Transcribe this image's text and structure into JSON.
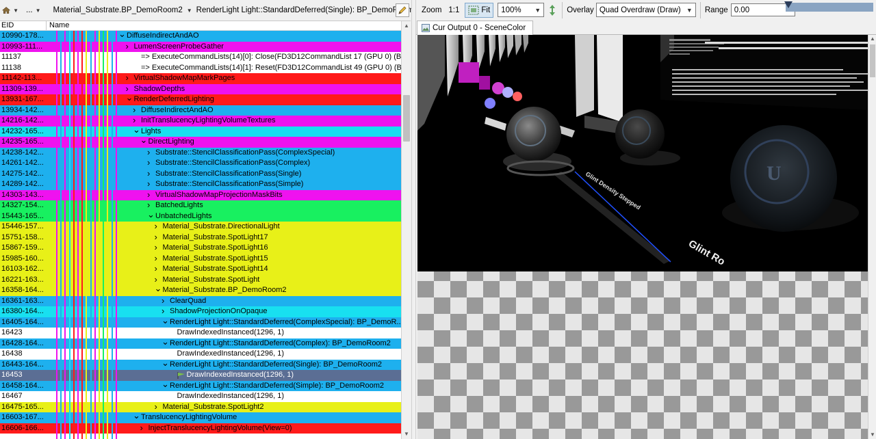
{
  "breadcrumb": {
    "home_icon": "home-icon",
    "item1": "Material_Substrate.BP_DemoRoom2",
    "item2": "RenderLight Light::StandardDeferred(Single): BP_DemoRoom2",
    "edit_icon": "pencil-icon"
  },
  "tree": {
    "columns": {
      "eid": "EID",
      "name": "Name"
    },
    "rows": [
      {
        "eid": "10990-178...",
        "name": "DiffuseIndirectAndAO",
        "color": "#1eb0ee",
        "depth": 0,
        "exp": "down"
      },
      {
        "eid": "10993-111...",
        "name": "LumenScreenProbeGather",
        "color": "#ef12ef",
        "depth": 1,
        "exp": "right"
      },
      {
        "eid": "11137",
        "name": "=> ExecuteCommandLists(14)[0]: Close(FD3D12CommandList 17 (GPU 0) (Bak",
        "color": "#ffffff",
        "depth": 2,
        "exp": ""
      },
      {
        "eid": "11138",
        "name": "=> ExecuteCommandLists(14)[1]: Reset(FD3D12CommandList 49 (GPU 0) (Bak",
        "color": "#ffffff",
        "depth": 2,
        "exp": ""
      },
      {
        "eid": "11142-113...",
        "name": "VirtualShadowMapMarkPages",
        "color": "#ff1a1a",
        "depth": 1,
        "exp": "right"
      },
      {
        "eid": "11309-139...",
        "name": "ShadowDepths",
        "color": "#ef12ef",
        "depth": 1,
        "exp": "right"
      },
      {
        "eid": "13931-167...",
        "name": "RenderDeferredLighting",
        "color": "#ff1a1a",
        "depth": 1,
        "exp": "down"
      },
      {
        "eid": "13934-142...",
        "name": "DiffuseIndirectAndAO",
        "color": "#1eb0ee",
        "depth": 2,
        "exp": "right"
      },
      {
        "eid": "14216-142...",
        "name": "InitTranslucencyLightingVolumeTextures",
        "color": "#ef12ef",
        "depth": 2,
        "exp": "right"
      },
      {
        "eid": "14232-165...",
        "name": "Lights",
        "color": "#18e0f0",
        "depth": 2,
        "exp": "down"
      },
      {
        "eid": "14235-165...",
        "name": "DirectLighting",
        "color": "#ef12ef",
        "depth": 3,
        "exp": "down"
      },
      {
        "eid": "14238-142...",
        "name": "Substrate::StencilClassificationPass(ComplexSpecial)",
        "color": "#1eb0ee",
        "depth": 4,
        "exp": "right"
      },
      {
        "eid": "14261-142...",
        "name": "Substrate::StencilClassificationPass(Complex)",
        "color": "#1eb0ee",
        "depth": 4,
        "exp": "right"
      },
      {
        "eid": "14275-142...",
        "name": "Substrate::StencilClassificationPass(Single)",
        "color": "#1eb0ee",
        "depth": 4,
        "exp": "right"
      },
      {
        "eid": "14289-142...",
        "name": "Substrate::StencilClassificationPass(Simple)",
        "color": "#1eb0ee",
        "depth": 4,
        "exp": "right"
      },
      {
        "eid": "14303-143...",
        "name": "VirtualShadowMapProjectionMaskBits",
        "color": "#ef12ef",
        "depth": 4,
        "exp": "right"
      },
      {
        "eid": "14327-154...",
        "name": "BatchedLights",
        "color": "#18f060",
        "depth": 4,
        "exp": "right"
      },
      {
        "eid": "15443-165...",
        "name": "UnbatchedLights",
        "color": "#18f060",
        "depth": 4,
        "exp": "down"
      },
      {
        "eid": "15446-157...",
        "name": "Material_Substrate.DirectionalLight",
        "color": "#e8f018",
        "depth": 5,
        "exp": "right"
      },
      {
        "eid": "15751-158...",
        "name": "Material_Substrate.SpotLight17",
        "color": "#e8f018",
        "depth": 5,
        "exp": "right"
      },
      {
        "eid": "15867-159...",
        "name": "Material_Substrate.SpotLight16",
        "color": "#e8f018",
        "depth": 5,
        "exp": "right"
      },
      {
        "eid": "15985-160...",
        "name": "Material_Substrate.SpotLight15",
        "color": "#e8f018",
        "depth": 5,
        "exp": "right"
      },
      {
        "eid": "16103-162...",
        "name": "Material_Substrate.SpotLight14",
        "color": "#e8f018",
        "depth": 5,
        "exp": "right"
      },
      {
        "eid": "16221-163...",
        "name": "Material_Substrate.SpotLight",
        "color": "#e8f018",
        "depth": 5,
        "exp": "right"
      },
      {
        "eid": "16358-164...",
        "name": "Material_Substrate.BP_DemoRoom2",
        "color": "#e8f018",
        "depth": 5,
        "exp": "down"
      },
      {
        "eid": "16361-163...",
        "name": "ClearQuad",
        "color": "#1eb0ee",
        "depth": 6,
        "exp": "right"
      },
      {
        "eid": "16380-164...",
        "name": "ShadowProjectionOnOpaque",
        "color": "#18e0f0",
        "depth": 6,
        "exp": "right"
      },
      {
        "eid": "16405-164...",
        "name": "RenderLight Light::StandardDeferred(ComplexSpecial): BP_DemoR...",
        "color": "#1eb0ee",
        "depth": 6,
        "exp": "down"
      },
      {
        "eid": "16423",
        "name": "DrawIndexedInstanced(1296, 1)",
        "color": "#ffffff",
        "depth": 7,
        "exp": ""
      },
      {
        "eid": "16428-164...",
        "name": "RenderLight Light::StandardDeferred(Complex): BP_DemoRoom2",
        "color": "#1eb0ee",
        "depth": 6,
        "exp": "down"
      },
      {
        "eid": "16438",
        "name": "DrawIndexedInstanced(1296, 1)",
        "color": "#ffffff",
        "depth": 7,
        "exp": ""
      },
      {
        "eid": "16443-164...",
        "name": "RenderLight Light::StandardDeferred(Single): BP_DemoRoom2",
        "color": "#1eb0ee",
        "depth": 6,
        "exp": "down"
      },
      {
        "eid": "16453",
        "name": "DrawIndexedInstanced(1296, 1)",
        "color": "#5b6e94",
        "depth": 7,
        "exp": "",
        "selected": true,
        "flag": true
      },
      {
        "eid": "16458-164...",
        "name": "RenderLight Light::StandardDeferred(Simple): BP_DemoRoom2",
        "color": "#1eb0ee",
        "depth": 6,
        "exp": "down"
      },
      {
        "eid": "16467",
        "name": "DrawIndexedInstanced(1296, 1)",
        "color": "#ffffff",
        "depth": 7,
        "exp": ""
      },
      {
        "eid": "16475-165...",
        "name": "Material_Substrate.SpotLight2",
        "color": "#e8f018",
        "depth": 5,
        "exp": "right"
      },
      {
        "eid": "16603-167...",
        "name": "TranslucencyLightingVolume",
        "color": "#1eb0ee",
        "depth": 2,
        "exp": "down"
      },
      {
        "eid": "16606-166...",
        "name": "InjectTranslucencyLightingVolume(View=0)",
        "color": "#ff1a1a",
        "depth": 3,
        "exp": "right"
      }
    ],
    "marker_colors": [
      "#ef12ef",
      "#1eb0ee",
      "#ef12ef",
      "#18e0f0",
      "#ff1a1a",
      "#ef12ef",
      "#ff1a1a",
      "#e8f018",
      "#1eb0ee",
      "#ef12ef",
      "#e8f018",
      "#18f060",
      "#e8f018",
      "#1eb0ee",
      "#ef12ef"
    ]
  },
  "toolbar": {
    "zoom_label": "Zoom",
    "one_to_one": "1:1",
    "fit_label": "Fit",
    "zoom_value": "100%",
    "flip_icon": "flip-vertical-icon",
    "overlay_label": "Overlay",
    "overlay_value": "Quad Overdraw (Draw)",
    "range_label": "Range",
    "range_value": "0.00"
  },
  "output": {
    "tab_label": "Cur Output 0 - SceneColor",
    "scene_text_1": "Glint Density Stepped",
    "scene_text_2": "Glint Ro"
  },
  "colors": {
    "selected_row": "#5b6e94",
    "fit_active": "#d8e6f2"
  }
}
